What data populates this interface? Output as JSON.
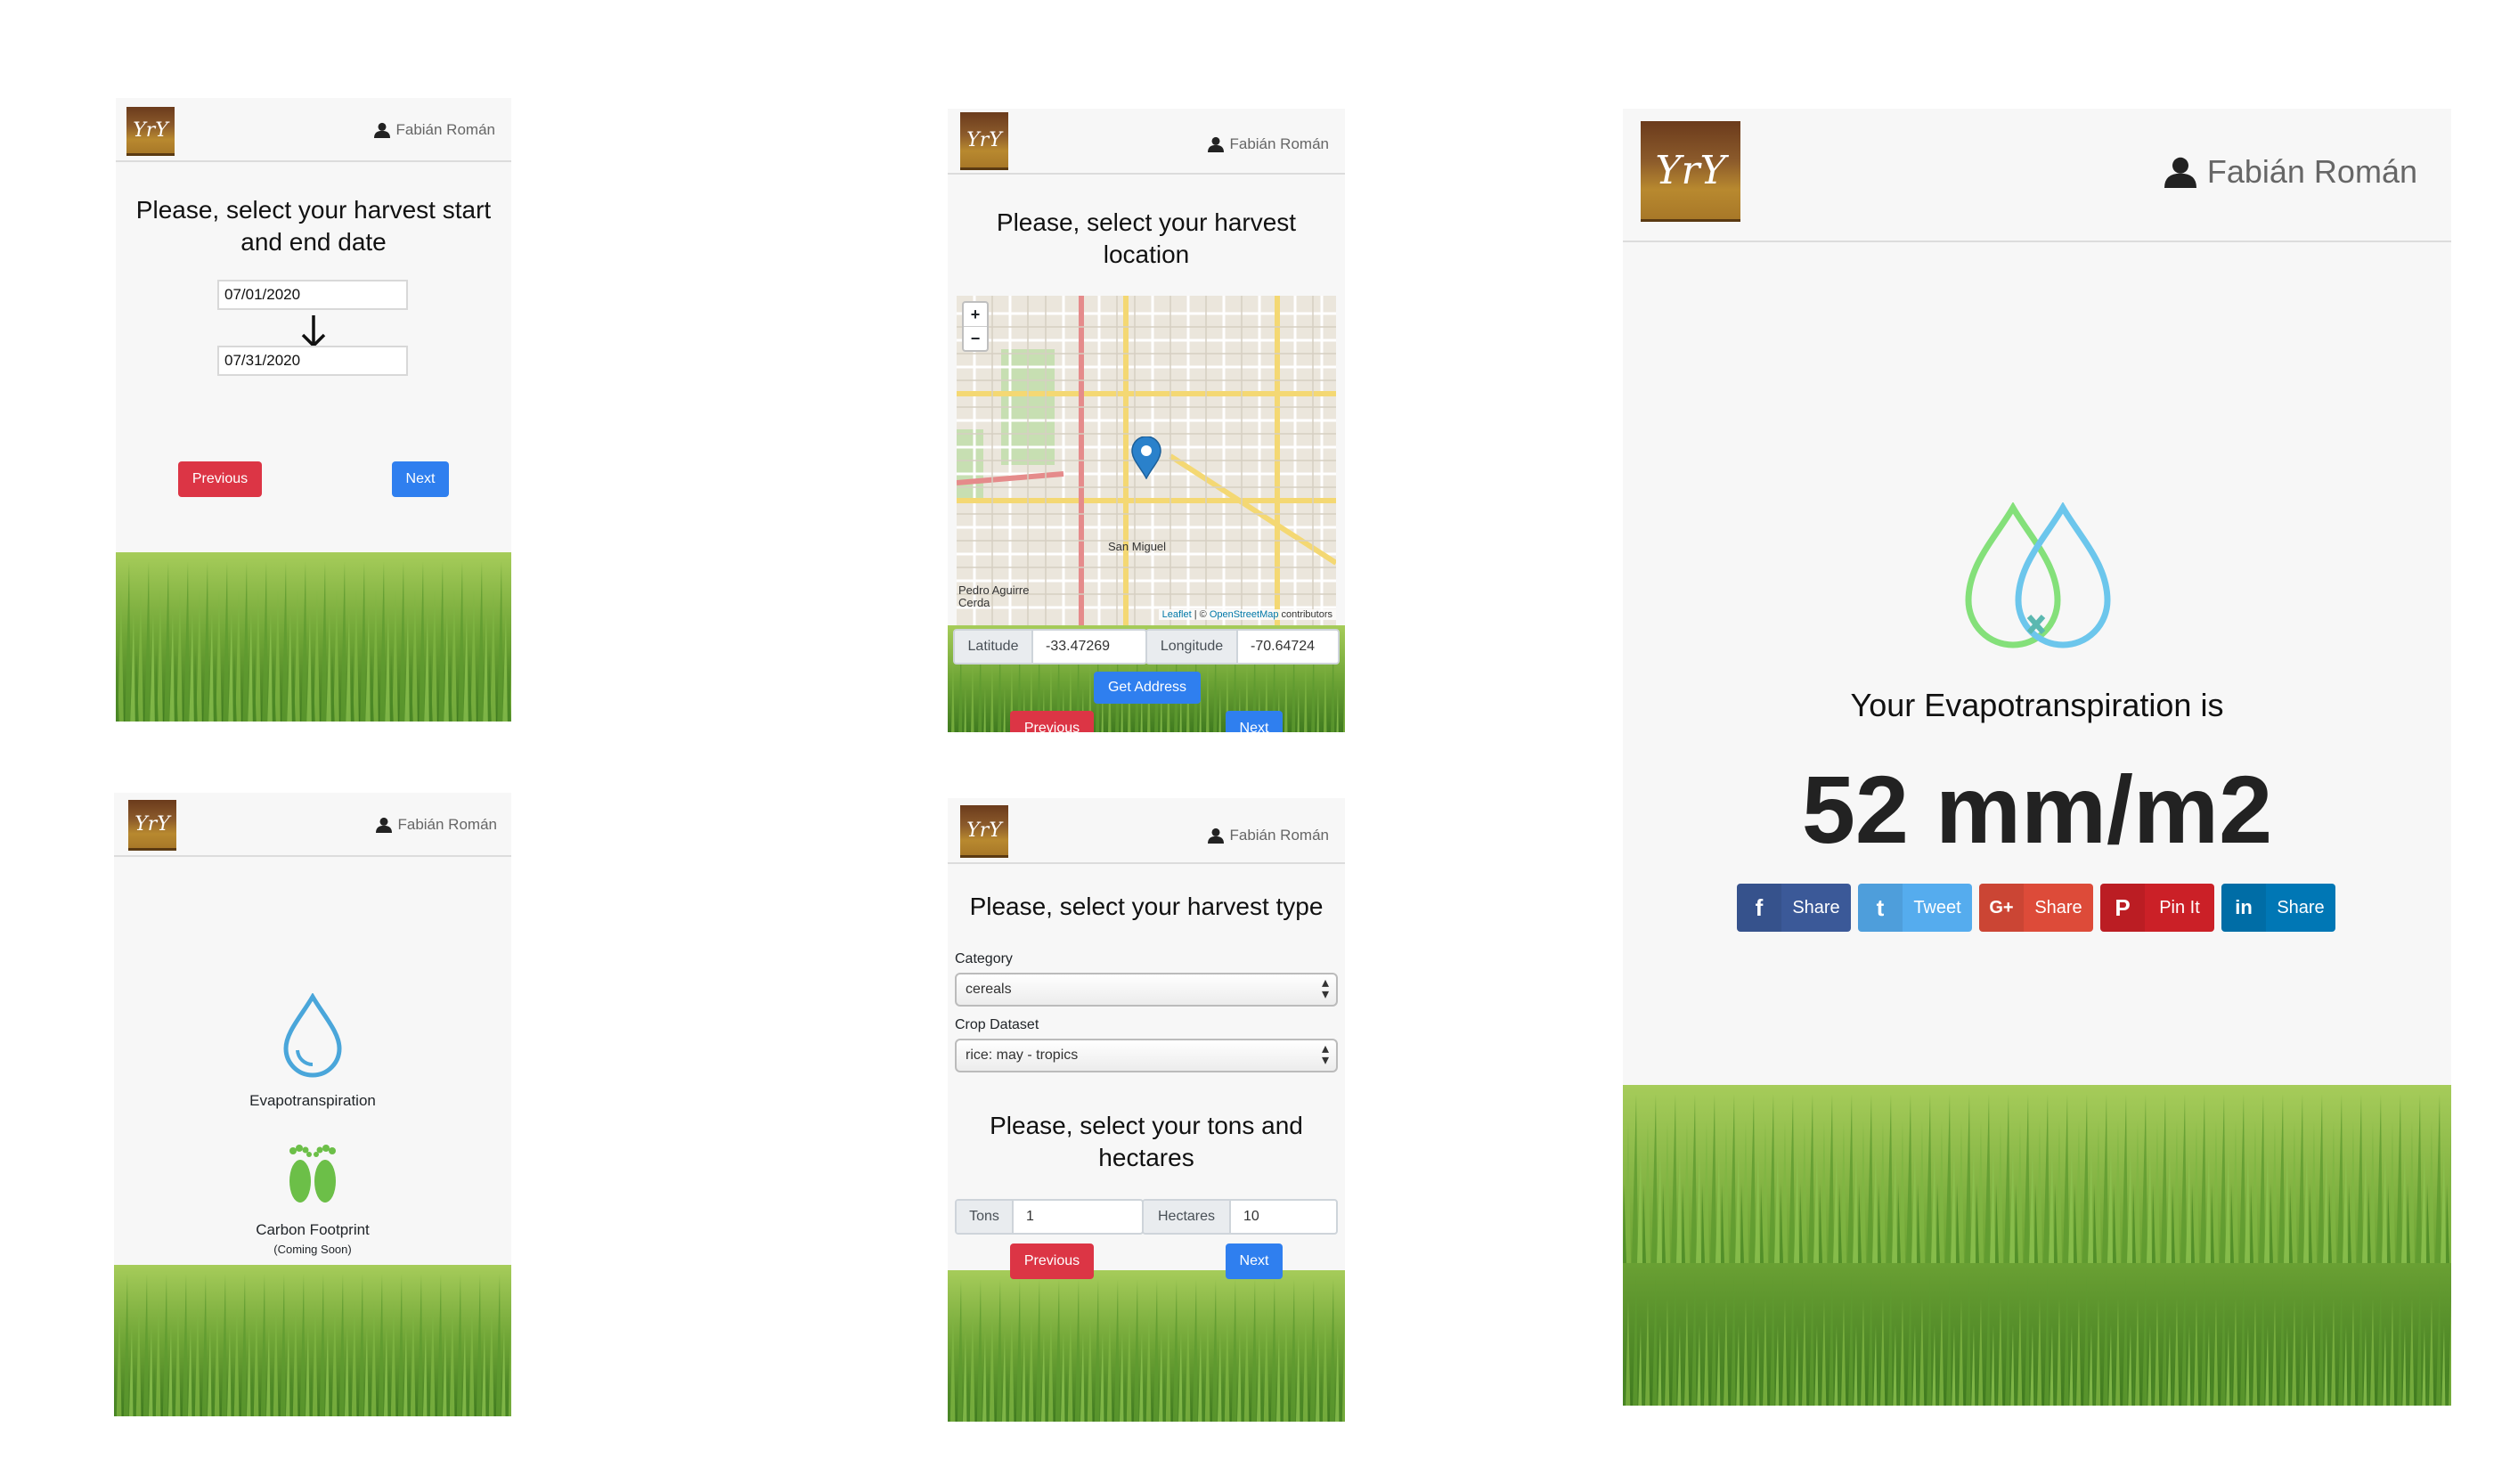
{
  "user": {
    "name": "Fabián Román"
  },
  "logo": {
    "text": "YrY"
  },
  "dates_screen": {
    "title": "Please, select your harvest start and end date",
    "start_date": "07/01/2020",
    "end_date": "07/31/2020",
    "previous_label": "Previous",
    "next_label": "Next"
  },
  "location_screen": {
    "title": "Please, select your harvest location",
    "zoom_in": "+",
    "zoom_out": "−",
    "map_labels": [
      "San Miguel",
      "Pedro Aguirre Cerda"
    ],
    "attribution_leaflet": "Leaflet",
    "attribution_sep": " | © ",
    "attribution_osm": "OpenStreetMap",
    "attribution_tail": " contributors",
    "latitude_label": "Latitude",
    "latitude_value": "-33.47269",
    "longitude_label": "Longitude",
    "longitude_value": "-70.64724",
    "get_address_label": "Get Address",
    "previous_label": "Previous",
    "next_label": "Next"
  },
  "menu_screen": {
    "evapo_label": "Evapotranspiration",
    "carbon_label": "Carbon Footprint",
    "carbon_note": "(Coming Soon)"
  },
  "type_screen": {
    "title": "Please, select your harvest type",
    "category_label": "Category",
    "category_value": "cereals",
    "dataset_label": "Crop Dataset",
    "dataset_value": "rice: may - tropics",
    "tons_title": "Please, select your tons and hectares",
    "tons_label": "Tons",
    "tons_value": "1",
    "hectares_label": "Hectares",
    "hectares_value": "10",
    "previous_label": "Previous",
    "next_label": "Next"
  },
  "result_screen": {
    "heading": "Your Evapotranspiration is",
    "value": "52 mm/m2",
    "shares": [
      {
        "icon": "f",
        "label": "Share",
        "color": "#3b5998"
      },
      {
        "icon": "t",
        "label": "Tweet",
        "color": "#55acee"
      },
      {
        "icon": "G+",
        "label": "Share",
        "color": "#dd4b39"
      },
      {
        "icon": "P",
        "label": "Pin It",
        "color": "#cb2027"
      },
      {
        "icon": "in",
        "label": "Share",
        "color": "#0077b5"
      }
    ]
  },
  "colors": {
    "primary": "#2f7fef",
    "danger": "#dc3545",
    "water": "#5bb8e8",
    "leaf": "#7ed957"
  }
}
